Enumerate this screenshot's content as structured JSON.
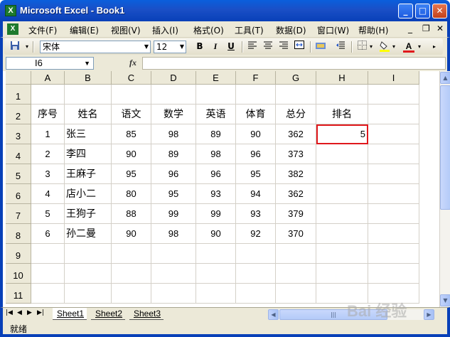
{
  "window": {
    "title": "Microsoft Excel - Book1",
    "app_icon": "X",
    "minimize": "_",
    "maximize": "□",
    "close": "✕"
  },
  "menu": {
    "items": [
      "文件(F)",
      "编辑(E)",
      "视图(V)",
      "插入(I)",
      "格式(O)",
      "工具(T)",
      "数据(D)",
      "窗口(W)",
      "帮助(H)"
    ],
    "doc_minimize": "_",
    "doc_restore": "❐",
    "doc_close": "✕"
  },
  "toolbar": {
    "font_name": "宋体",
    "font_size": "12",
    "bold": "B",
    "italic": "I",
    "underline": "U",
    "font_color_letter": "A",
    "colors": {
      "fill": "#ffff00",
      "font": "#e0181c"
    }
  },
  "formula_bar": {
    "name_box": "I6",
    "fx": "fx",
    "formula": ""
  },
  "grid": {
    "columns": [
      "A",
      "B",
      "C",
      "D",
      "E",
      "F",
      "G",
      "H",
      "I"
    ],
    "rows": [
      "1",
      "2",
      "3",
      "4",
      "5",
      "6",
      "7",
      "8",
      "9",
      "10",
      "11"
    ],
    "headers": [
      "序号",
      "姓名",
      "语文",
      "数学",
      "英语",
      "体育",
      "总分",
      "排名"
    ],
    "records": [
      [
        "1",
        "张三",
        "85",
        "98",
        "89",
        "90",
        "362",
        "5"
      ],
      [
        "2",
        "李四",
        "90",
        "89",
        "98",
        "96",
        "373",
        ""
      ],
      [
        "3",
        "王麻子",
        "95",
        "96",
        "96",
        "95",
        "382",
        ""
      ],
      [
        "4",
        "店小二",
        "80",
        "95",
        "93",
        "94",
        "362",
        ""
      ],
      [
        "5",
        "王狗子",
        "88",
        "99",
        "99",
        "93",
        "379",
        ""
      ],
      [
        "6",
        "孙二曼",
        "90",
        "98",
        "90",
        "92",
        "370",
        ""
      ]
    ],
    "highlight_color": "#e0181c"
  },
  "sheets": {
    "tabs": [
      "Sheet1",
      "Sheet2",
      "Sheet3"
    ],
    "active": "Sheet1"
  },
  "status": {
    "text": "就绪"
  },
  "watermark": "Bai 经验"
}
